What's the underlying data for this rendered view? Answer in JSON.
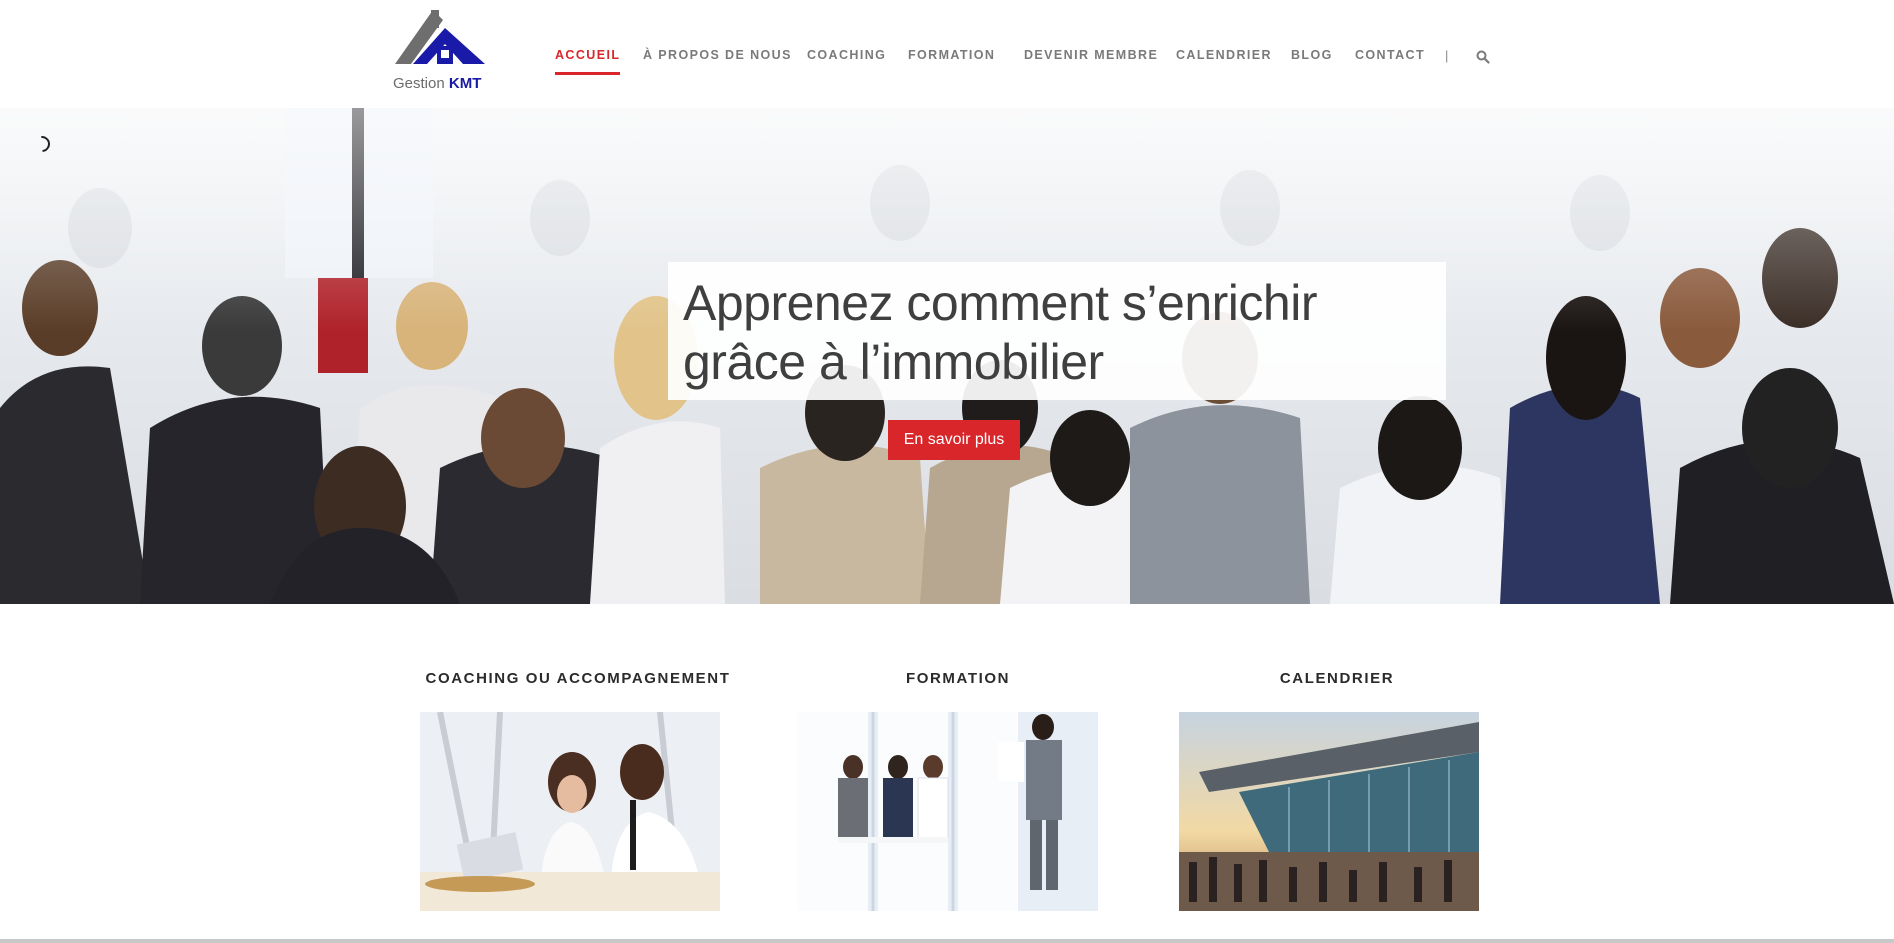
{
  "header": {
    "logo": {
      "name": "Gestion",
      "brand": "KMT",
      "icon": "house-logo-icon"
    },
    "nav": [
      {
        "label": "ACCUEIL",
        "active": true
      },
      {
        "label": "À PROPOS DE NOUS",
        "active": false
      },
      {
        "label": "COACHING",
        "active": false
      },
      {
        "label": "FORMATION",
        "active": false
      },
      {
        "label": "DEVENIR MEMBRE",
        "active": false
      },
      {
        "label": "CALENDRIER",
        "active": false
      },
      {
        "label": "BLOG",
        "active": false
      },
      {
        "label": "CONTACT",
        "active": false
      }
    ],
    "separator": "|",
    "search_icon": "search-icon"
  },
  "hero": {
    "title_line1": "Apprenez comment s’enrichir",
    "title_line2": "grâce à l’immobilier",
    "cta_label": "En savoir plus",
    "loading_icon": "loading-spinner-icon"
  },
  "features": [
    {
      "title": "COACHING OU ACCOMPAGNEMENT",
      "image": "coaching-meeting-photo"
    },
    {
      "title": "FORMATION",
      "image": "training-session-photo"
    },
    {
      "title": "CALENDRIER",
      "image": "event-venue-photo"
    }
  ],
  "colors": {
    "accent": "#d9262b",
    "nav_text": "#7a7a7a",
    "heading_text": "#2b2b2b",
    "logo_blue": "#1a1aa8"
  }
}
